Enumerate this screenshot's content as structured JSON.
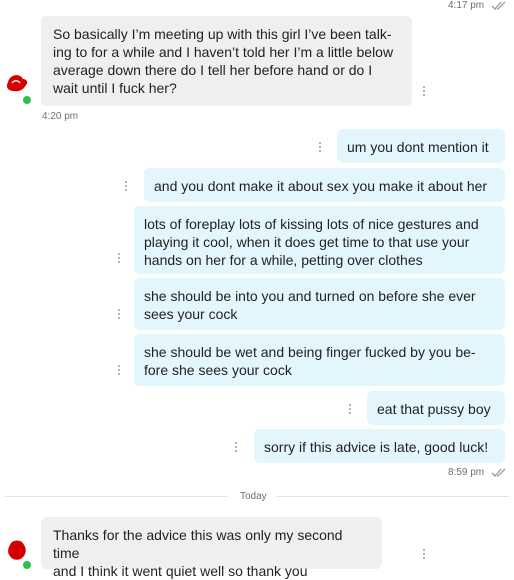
{
  "header": {
    "time": "4:17 pm"
  },
  "messages": {
    "incoming1": {
      "text": "So basically I’m meeting up with this girl I’ve been talk-ing to for a while and I haven’t told her I’m a little below average down there do I tell her before hand or do I wait until I fuck her?",
      "lines": [
        "So basically I’m meeting up with this girl I’ve been talk-",
        "ing to for a while and I haven’t told her I’m a little below",
        "average down there do I tell her before hand or do I",
        "wait until I fuck her?"
      ],
      "time": "4:20 pm"
    },
    "out1": "um you dont mention it",
    "out2": "and you dont make it about sex you make it about her",
    "out3": {
      "lines": [
        "lots of foreplay lots of kissing lots of nice gestures and",
        "playing it cool, when it does get time to that use your",
        "hands on her for a while, petting over clothes"
      ]
    },
    "out4": {
      "lines": [
        "she should be into you and turned on before she ever",
        "sees your cock"
      ]
    },
    "out5": {
      "lines": [
        "she should be wet and being finger fucked by you be-",
        "fore she sees your cock"
      ]
    },
    "out6": "eat that pussy boy",
    "out7": "sorry if this advice is late, good luck!",
    "out_time": "8:59 pm",
    "divider": "Today",
    "incoming2": {
      "lines": [
        "Thanks for the advice this was only my second time",
        "and I think it went quiet well so thank you"
      ]
    }
  },
  "colors": {
    "incoming_bg": "#efefef",
    "outgoing_bg": "#e3f6fd",
    "online": "#2fbf4b",
    "avatar_red": "#d40000"
  },
  "icons": [
    "read-check-icon",
    "kebab-menu-icon",
    "avatar-icon",
    "online-dot-icon"
  ]
}
